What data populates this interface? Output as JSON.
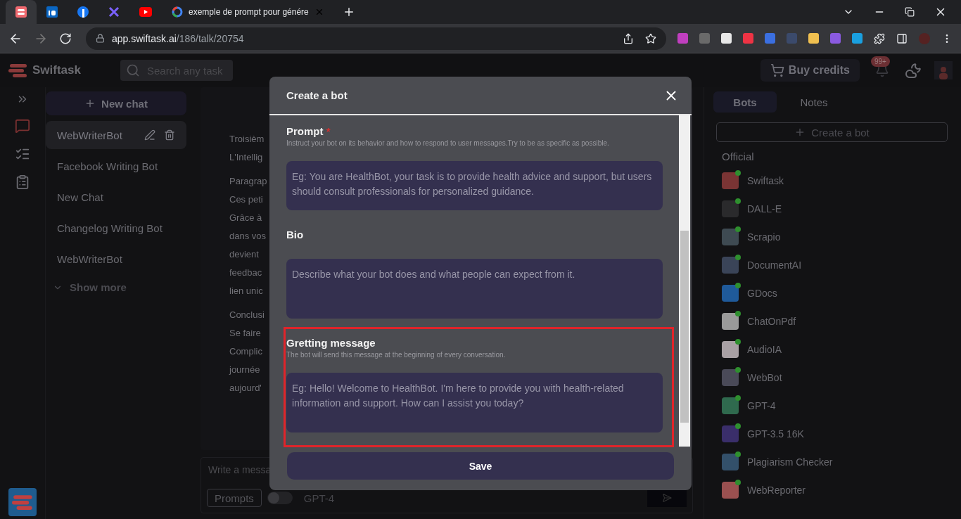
{
  "browser": {
    "tabs": [
      {
        "selected": true
      },
      {
        "selected": false
      },
      {
        "selected": false
      },
      {
        "selected": false
      },
      {
        "selected": false
      },
      {
        "title": "exemple de prompt pour génére",
        "selected": false
      }
    ],
    "address": {
      "domain": "app.swiftask.ai",
      "path": "/186/talk/20754"
    }
  },
  "header": {
    "brand": "Swiftask",
    "search_placeholder": "Search any task",
    "buy_credits": "Buy credits",
    "notification_badge": "99+"
  },
  "rail": [
    {
      "selected": true
    },
    {
      "selected": false
    },
    {
      "selected": false
    }
  ],
  "sidebar": {
    "new_chat": "New chat",
    "chats": [
      {
        "title": "WebWriterBot",
        "selected": true
      },
      {
        "title": "Facebook Writing Bot",
        "selected": false
      },
      {
        "title": "New Chat",
        "selected": false
      },
      {
        "title": "Changelog Writing Bot",
        "selected": false
      },
      {
        "title": "WebWriterBot",
        "selected": false
      }
    ],
    "show_more": "Show more"
  },
  "chat": {
    "paragraphs": [
      [
        "Troisièm",
        "L'Intellig"
      ],
      [
        "Paragrap",
        "Ces peti",
        "Grâce à",
        "dans vos",
        "devient",
        "feedbac",
        "lien unic"
      ],
      [
        "Conclusi",
        "Se faire",
        "Complic",
        "journée",
        "aujourd'"
      ]
    ],
    "composer": {
      "placeholder": "Write a messa",
      "prompts": "Prompts",
      "toggle_on": false,
      "model": "GPT-4"
    }
  },
  "right_panel": {
    "tabs": [
      {
        "label": "Bots",
        "selected": true
      },
      {
        "label": "Notes",
        "selected": false
      }
    ],
    "create_bot": "Create a bot",
    "section": "Official",
    "bots": [
      {
        "name": "Swiftask",
        "online": true
      },
      {
        "name": "DALL-E",
        "online": true
      },
      {
        "name": "Scrapio",
        "online": true
      },
      {
        "name": "DocumentAI",
        "online": true
      },
      {
        "name": "GDocs",
        "online": true
      },
      {
        "name": "ChatOnPdf",
        "online": true
      },
      {
        "name": "AudioIA",
        "online": true
      },
      {
        "name": "WebBot",
        "online": true
      },
      {
        "name": "GPT-4",
        "online": true
      },
      {
        "name": "GPT-3.5 16K",
        "online": true
      },
      {
        "name": "Plagiarism Checker",
        "online": true
      },
      {
        "name": "WebReporter",
        "online": true
      }
    ]
  },
  "modal": {
    "title": "Create a bot",
    "fields": [
      {
        "label": "Prompt",
        "required_mark": "*",
        "hint": "Instruct your bot on its behavior and how to respond to user messages.Try to be as specific as possible.",
        "placeholder": "Eg: You are HealthBot, your task is to provide health advice and support, but users should consult professionals for personalized guidance.",
        "highlighted": false
      },
      {
        "label": "Bio",
        "placeholder": "Describe what your bot does and what people can expect from it.",
        "highlighted": false
      },
      {
        "label": "Gretting message",
        "hint": "The bot will send this message at the beginning of every conversation.",
        "placeholder": "Eg: Hello! Welcome to HealthBot. I'm here to provide you with health-related information and support. How can I assist you today?",
        "highlighted": true
      }
    ],
    "save": "Save"
  }
}
